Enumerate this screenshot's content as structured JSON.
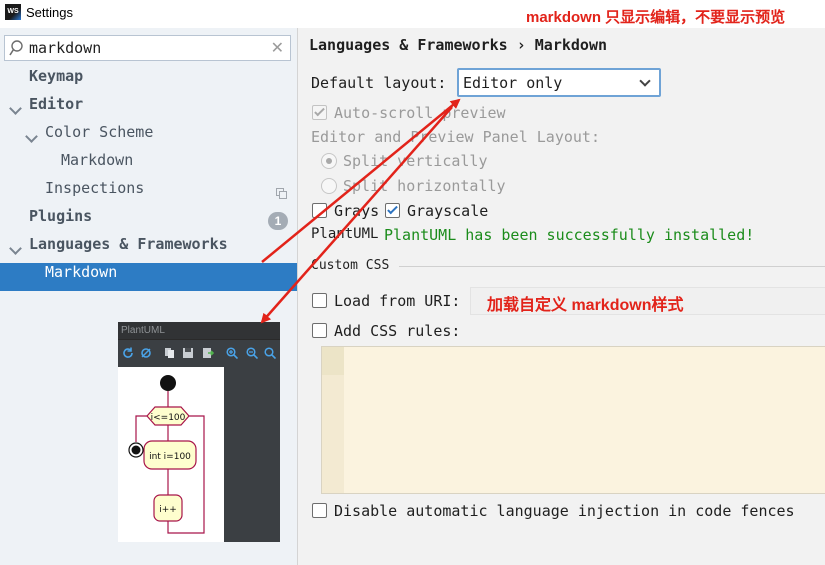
{
  "window": {
    "icon_text": "WS",
    "title": "Settings",
    "annotation": "markdown 只显示编辑，不要显示预览"
  },
  "sidebar": {
    "search_value": "markdown",
    "items": [
      {
        "label": "Keymap"
      },
      {
        "label": "Editor"
      },
      {
        "label": "Color Scheme"
      },
      {
        "label": "Markdown"
      },
      {
        "label": "Inspections"
      },
      {
        "label": "Plugins",
        "badge": "1"
      },
      {
        "label": "Languages & Frameworks"
      },
      {
        "label": "Markdown",
        "selected": true
      }
    ]
  },
  "preview": {
    "title": "PlantUML",
    "diagram": {
      "decision": "i<=100",
      "step1": "int i=100",
      "step2": "i++"
    }
  },
  "main": {
    "breadcrumb": "Languages & Frameworks › Markdown",
    "default_layout_label": "Default layout:",
    "default_layout_value": "Editor only",
    "auto_scroll_label": "Auto-scroll preview",
    "auto_scroll_checked": true,
    "panel_layout_label": "Editor and Preview Panel Layout:",
    "split_vertically": "Split vertically",
    "split_horizontally": "Split horizontally",
    "grays_label": "Grays",
    "grayscale_label": "Grayscale",
    "grayscale_checked": true,
    "plantuml_label": "PlantUML",
    "plantuml_status": "PlantUML has been successfully installed!",
    "custom_css_label": "Custom CSS",
    "load_from_uri_label": "Load from URI:",
    "load_uri_annotation": "加载自定义 markdown样式",
    "add_css_rules_label": "Add CSS rules:",
    "disable_injection_label": "Disable automatic language injection in code fences"
  },
  "colors": {
    "selection": "#2d7cc4",
    "annotation_red": "#e2231a",
    "success_green": "#1b8c1b",
    "css_editor_bg": "#fbf3df"
  }
}
